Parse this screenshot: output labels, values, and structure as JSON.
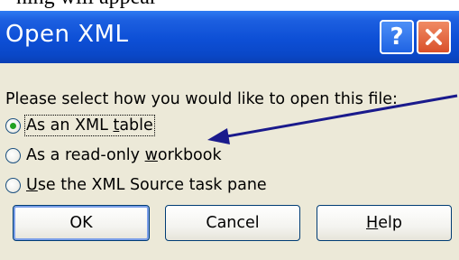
{
  "caption": "ning will appear",
  "window": {
    "title": "Open XML",
    "help_glyph": "?",
    "close_icon": "close-x-icon",
    "title_color": "#0a47c7"
  },
  "prompt": "Please select how you would like to open this file:",
  "options": [
    {
      "pre": "As an XML ",
      "key": "t",
      "post": "able",
      "checked": true
    },
    {
      "pre": "As a read-only ",
      "key": "w",
      "post": "orkbook",
      "checked": false
    },
    {
      "pre": "",
      "key": "U",
      "post": "se the XML Source task pane",
      "checked": false
    }
  ],
  "buttons": {
    "ok": "OK",
    "cancel": "Cancel",
    "help_key": "H",
    "help_rest": "elp"
  },
  "annotation": {
    "arrow_color": "#1a1a8c"
  }
}
